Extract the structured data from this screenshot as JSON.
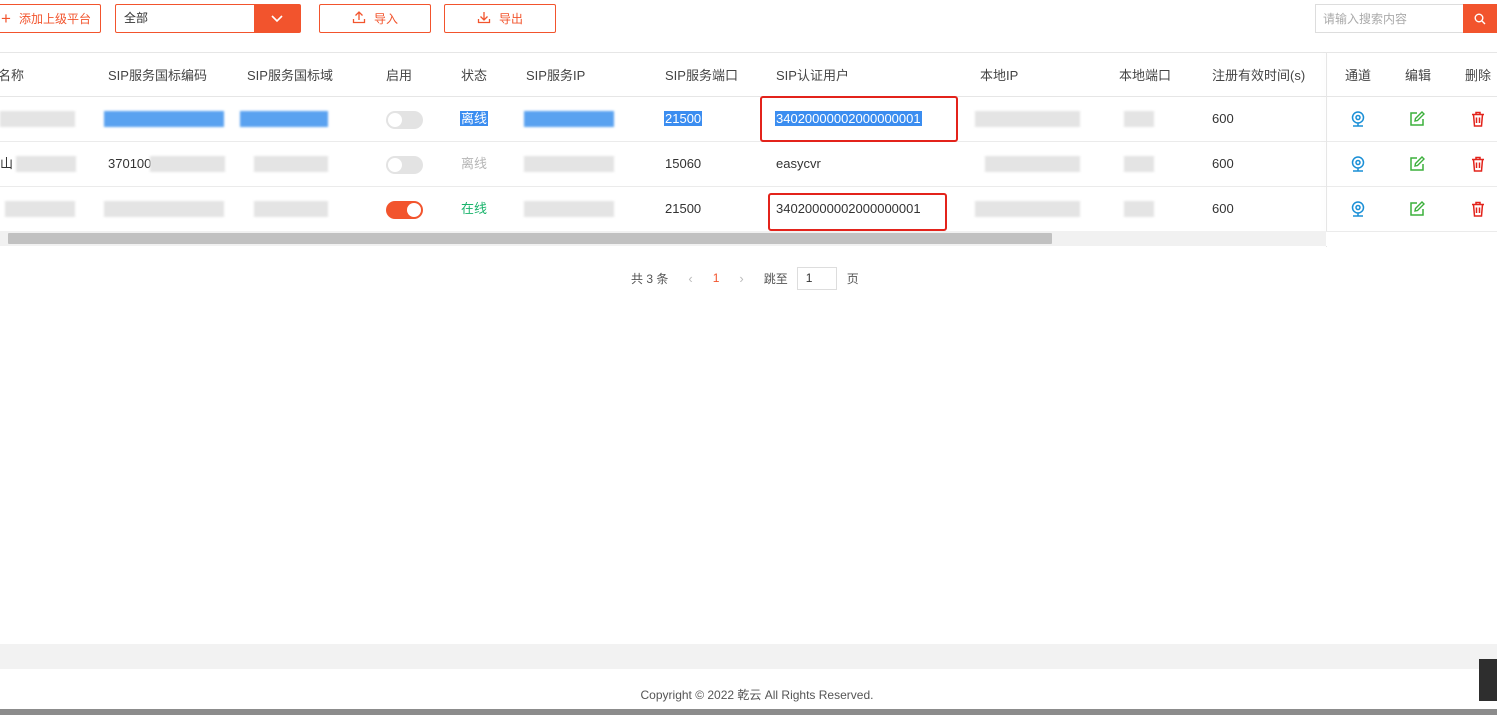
{
  "toolbar": {
    "add_label": "添加上级平台",
    "filter_value": "全部",
    "import_label": "导入",
    "export_label": "导出",
    "search_placeholder": "请输入搜索内容"
  },
  "table": {
    "headers": {
      "name": "名称",
      "sip_code": "SIP服务国标编码",
      "sip_domain": "SIP服务国标域",
      "enable": "启用",
      "status": "状态",
      "sip_ip": "SIP服务IP",
      "sip_port": "SIP服务端口",
      "sip_user": "SIP认证用户",
      "local_ip": "本地IP",
      "local_port": "本地端口",
      "expire": "注册有效时间(s)",
      "channel": "通道",
      "edit": "编辑",
      "delete": "删除"
    },
    "rows": [
      {
        "name": "",
        "sip_code": "",
        "enabled": false,
        "status": "离线",
        "sip_port": "21500",
        "sip_user": "34020000002000000001",
        "expire": "600"
      },
      {
        "name": "山",
        "sip_code": "370100",
        "enabled": false,
        "status": "离线",
        "sip_port": "15060",
        "sip_user": "easycvr",
        "expire": "600"
      },
      {
        "name": "",
        "sip_code": "",
        "enabled": true,
        "status": "在线",
        "sip_port": "21500",
        "sip_user": "34020000002000000001",
        "expire": "600"
      }
    ]
  },
  "pagination": {
    "total": "共 3 条",
    "current": "1",
    "jump_label": "跳至",
    "jump_value": "1",
    "page_suffix": "页"
  },
  "footer": {
    "copyright": "Copyright © 2022 乾云 All Rights Reserved."
  },
  "colors": {
    "accent": "#f2542d",
    "online": "#19b36b",
    "channel_icon": "#1a8fd6",
    "edit_icon": "#3cb03c",
    "delete_icon": "#e3231b"
  }
}
